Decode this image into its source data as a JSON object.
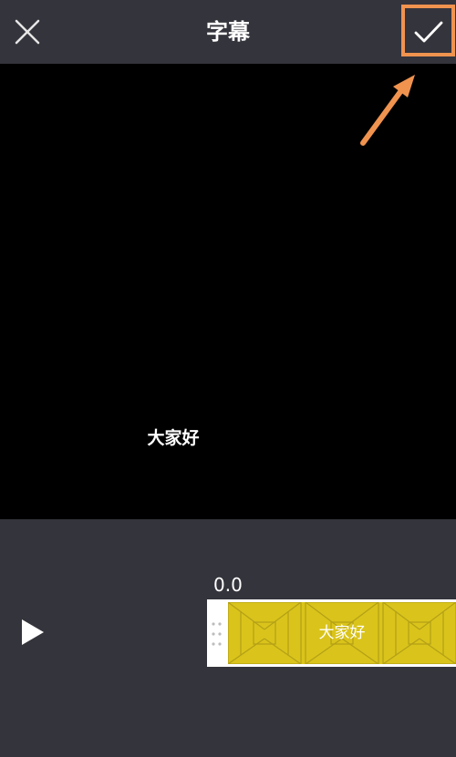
{
  "header": {
    "title": "字幕",
    "close_icon": "close-icon",
    "confirm_icon": "checkmark-icon"
  },
  "preview": {
    "subtitle_text": "大家好"
  },
  "timeline": {
    "timecode": "0.0",
    "play_icon": "play-icon",
    "clip_label": "大家好"
  },
  "colors": {
    "background": "#34343c",
    "preview_background": "#000000",
    "highlight": "#f0934f",
    "clip": "#d8c21a"
  }
}
